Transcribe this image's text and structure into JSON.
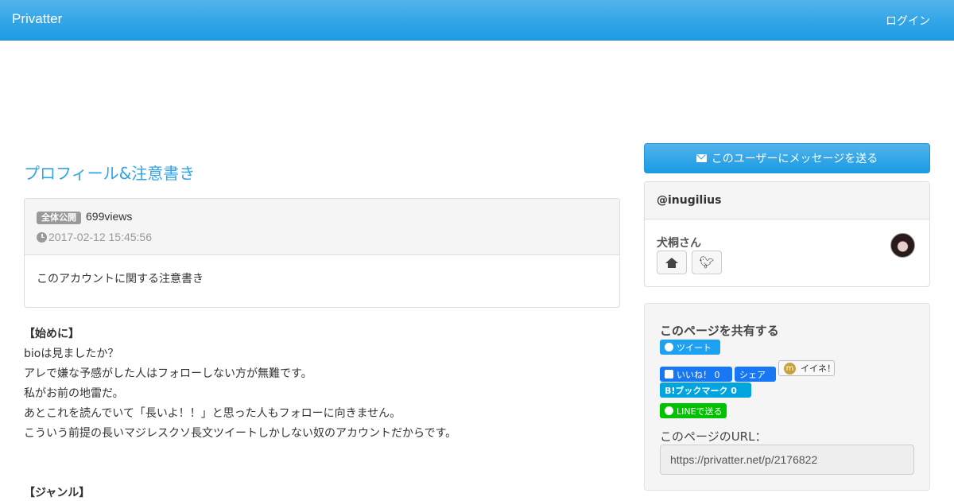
{
  "navbar": {
    "brand": "Privatter",
    "login": "ログイン"
  },
  "post": {
    "title": "プロフィール&注意書き",
    "visibility_badge": "全体公開",
    "views": "699views",
    "date": "2017-02-12 15:45:56",
    "summary": "このアカウントに関する注意書き",
    "body": [
      {
        "text": "【始めに】",
        "heading": true
      },
      {
        "text": "bioは見ましたか？",
        "heading": false
      },
      {
        "text": "アレで嫌な予感がした人はフォローしない方が無難です。",
        "heading": false
      },
      {
        "text": "私がお前の地雷だ。",
        "heading": false
      },
      {
        "text": "あとこれを読んでいて「長いよ！！」と思った人もフォローに向きません。",
        "heading": false
      },
      {
        "text": "こういう前提の長いマジレスクソ長文ツイートしかしない奴のアカウントだからです。",
        "heading": false
      },
      {
        "text": "【ジャンル】",
        "heading": true
      }
    ]
  },
  "sidebar": {
    "message_button": "このユーザーにメッセージを送る",
    "user": {
      "handle": "@inugilius",
      "name": "犬桐さん",
      "home_icon": "home-icon",
      "twitter_icon": "twitter-icon"
    },
    "share": {
      "title": "このページを共有する",
      "tweet": "ツイート",
      "like": "いいね！ 0",
      "fb_share": "シェア",
      "mixi": "イイネ！",
      "hatena": "B!ブックマーク 0",
      "line": "LINEで送る",
      "url_label": "このページのURL：",
      "url": "https://privatter.net/p/2176822"
    }
  },
  "colors": {
    "accent": "#2fa4e7",
    "twitter": "#1da1f2",
    "facebook": "#1877f2",
    "hatena": "#00a4de",
    "line": "#00c300"
  }
}
